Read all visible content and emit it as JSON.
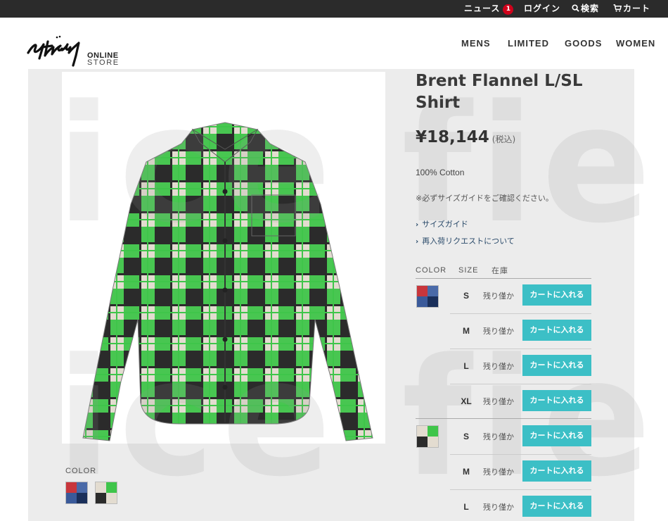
{
  "topbar": {
    "news_label": "ニュース",
    "news_count": "1",
    "login_label": "ログイン",
    "search_label": "検索",
    "cart_label": "カート"
  },
  "header": {
    "brand": "Stüssy",
    "online_label": "ONLINE",
    "store_label": "STORE",
    "nav": [
      "MENS",
      "LIMITED",
      "GOODS",
      "WOMEN"
    ]
  },
  "watermark": [
    "ice field",
    "ice field"
  ],
  "product": {
    "title": "Brent Flannel L/SL Shirt",
    "price": "¥18,144",
    "tax_label": "(税込)",
    "material": "100% Cotton",
    "size_note": "※必ずサイズガイドをご確認ください。",
    "links": [
      "サイズガイド",
      "再入荷リクエストについて"
    ],
    "color_label": "COLOR"
  },
  "stock_table": {
    "headers": [
      "COLOR",
      "SIZE",
      "在庫"
    ],
    "rows": [
      {
        "size": "S",
        "stock": "残り僅か",
        "button": "カートに入れる"
      },
      {
        "size": "M",
        "stock": "残り僅か",
        "button": "カートに入れる"
      },
      {
        "size": "L",
        "stock": "残り僅か",
        "button": "カートに入れる"
      },
      {
        "size": "XL",
        "stock": "残り僅か",
        "button": "カートに入れる"
      },
      {
        "size": "S",
        "stock": "残り僅か",
        "button": "カートに入れる"
      },
      {
        "size": "M",
        "stock": "残り僅か",
        "button": "カートに入れる"
      },
      {
        "size": "L",
        "stock": "残り僅か",
        "button": "カートに入れる"
      }
    ]
  },
  "colors": {
    "accent_button": "#3cbfc6",
    "topbar_bg": "#2b2b2b",
    "badge": "#d0021b",
    "plaid_green": "#3fc54a",
    "plaid_black": "#2b2b2b",
    "plaid_cream": "#e3dcd0"
  }
}
